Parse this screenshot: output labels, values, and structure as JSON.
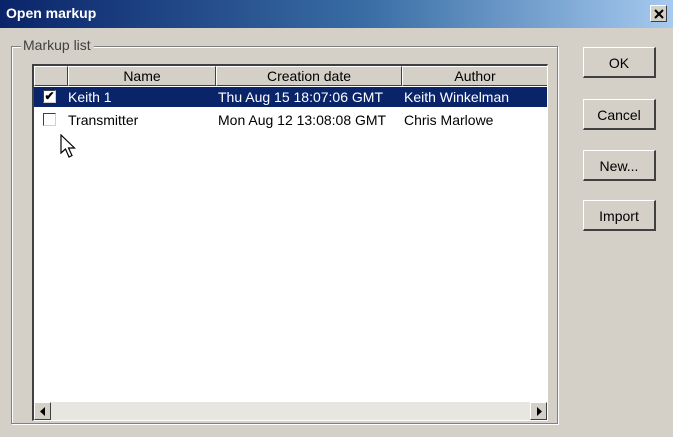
{
  "window": {
    "title": "Open markup",
    "close_glyph": "✕"
  },
  "group": {
    "label": "Markup list"
  },
  "list": {
    "columns": [
      "",
      "Name",
      "Creation date",
      "Author"
    ],
    "rows": [
      {
        "checked": true,
        "check_glyph": "✔",
        "name": "Keith 1",
        "date": "Thu Aug 15 18:07:06 GMT",
        "author": "Keith Winkelman",
        "selected": true
      },
      {
        "checked": false,
        "check_glyph": "",
        "name": "Transmitter",
        "date": "Mon Aug 12 13:08:08 GMT",
        "author": "Chris Marlowe",
        "selected": false
      }
    ],
    "scroll_left_icon": "left-arrow-icon",
    "scroll_right_icon": "right-arrow-icon"
  },
  "buttons": {
    "ok": "OK",
    "cancel": "Cancel",
    "new": "New...",
    "import": "Import"
  },
  "colors": {
    "title_bar": "#0a246a",
    "selection": "#0a246a",
    "face": "#d4d0c8"
  }
}
